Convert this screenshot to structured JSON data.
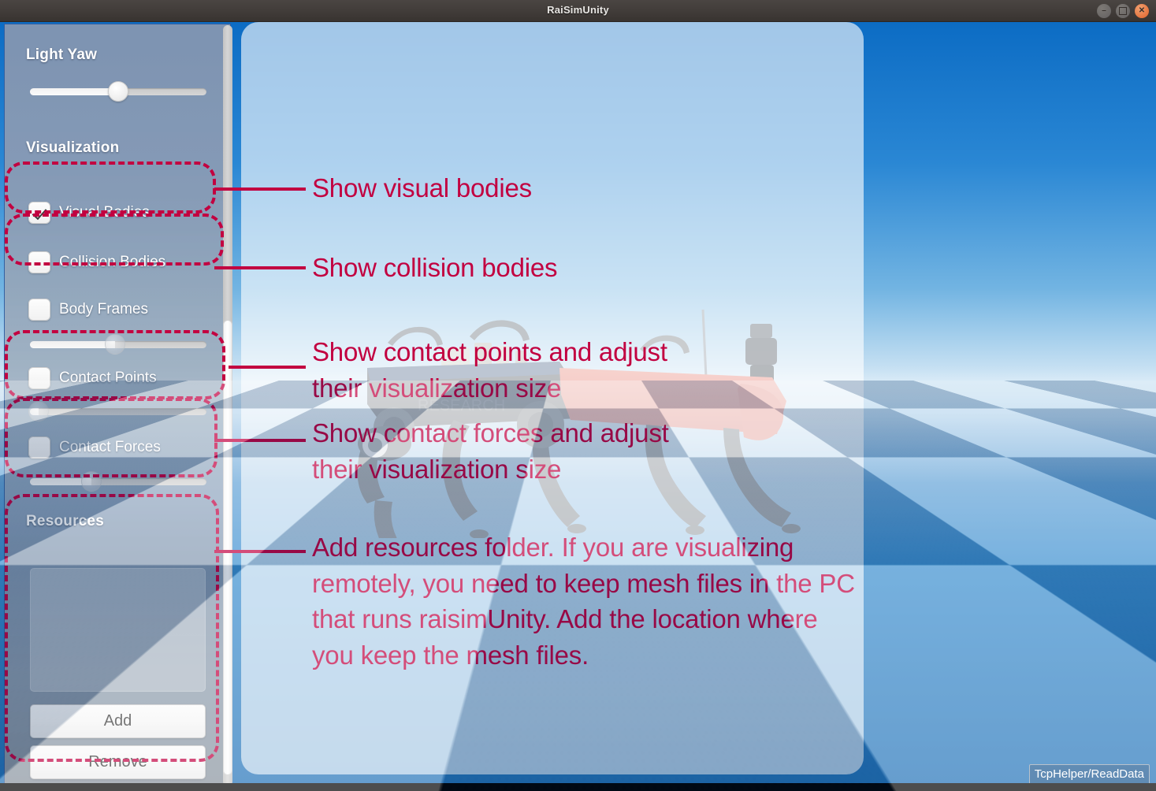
{
  "window": {
    "title": "RaiSimUnity",
    "buttons": {
      "minimize": "–",
      "maximize": "□",
      "close": "✕"
    }
  },
  "sidebar": {
    "light_yaw": {
      "label": "Light Yaw",
      "slider_value_pct": 50
    },
    "visualization": {
      "label": "Visualization",
      "checkboxes": [
        {
          "name": "visual-bodies",
          "label": "Visual Bodies",
          "checked": true
        },
        {
          "name": "collision-bodies",
          "label": "Collision Bodies",
          "checked": false
        },
        {
          "name": "body-frames",
          "label": "Body Frames",
          "checked": false
        },
        {
          "name": "contact-points",
          "label": "Contact Points",
          "checked": false
        },
        {
          "name": "contact-forces",
          "label": "Contact Forces",
          "checked": false
        }
      ],
      "sliders": [
        {
          "name": "body-frames-size",
          "value_pct": 48
        },
        {
          "name": "contact-points-size",
          "value_pct": 5
        },
        {
          "name": "contact-forces-size",
          "value_pct": 35
        }
      ]
    },
    "resources": {
      "label": "Resources",
      "list_items": [],
      "add_label": "Add",
      "remove_label": "Remove"
    },
    "scrollbar": {
      "name": "sidebar-scrollbar",
      "thumb_top_pct": 39,
      "thumb_height_pct": 60
    }
  },
  "annotations": {
    "accent_color": "#c20040",
    "items": [
      {
        "name": "annotation-visual-bodies",
        "text": "Show visual bodies"
      },
      {
        "name": "annotation-collision-bodies",
        "text": "Show collision bodies"
      },
      {
        "name": "annotation-contact-points",
        "text": "Show contact points and adjust\ntheir visualization size"
      },
      {
        "name": "annotation-contact-forces",
        "text": "Show contact forces and adjust\ntheir visualization size"
      },
      {
        "name": "annotation-resources",
        "text": "Add resources folder. If you are visualizing remotely, you need to keep mesh files in the PC that runs raisimUnity. Add the location where you keep the mesh files."
      }
    ]
  },
  "viewport": {
    "name": "3d-simulation-viewport",
    "scene": "quadruped robot on blue checkerboard ground plane",
    "sky_color_top": "#0c6cc4",
    "sky_color_bottom": "#e8f3fb",
    "floor_color_light": "#8fc0e4",
    "floor_color_dark": "#1d6cb4",
    "robot_body_color": "#3a3f46",
    "robot_accent_color": "#e0604f"
  },
  "status": {
    "badge_text": "TcpHelper/ReadData"
  }
}
